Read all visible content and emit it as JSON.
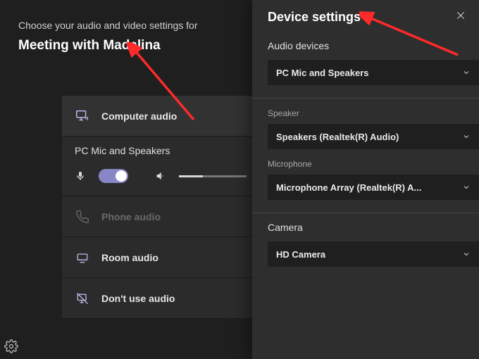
{
  "prompt": "Choose your audio and video settings for",
  "meeting_title": "Meeting with Madalina",
  "options": {
    "computer_audio": "Computer audio",
    "pc_mic_speakers": "PC Mic and Speakers",
    "phone_audio": "Phone audio",
    "room_audio": "Room audio",
    "dont_use_audio": "Don't use audio"
  },
  "panel": {
    "title": "Device settings",
    "audio_devices_label": "Audio devices",
    "audio_device_value": "PC Mic and Speakers",
    "speaker_label": "Speaker",
    "speaker_value": "Speakers (Realtek(R) Audio)",
    "mic_label": "Microphone",
    "mic_value": "Microphone Array (Realtek(R) A...",
    "camera_label": "Camera",
    "camera_value": "HD Camera"
  },
  "colors": {
    "arrow": "#ff2a2a"
  }
}
